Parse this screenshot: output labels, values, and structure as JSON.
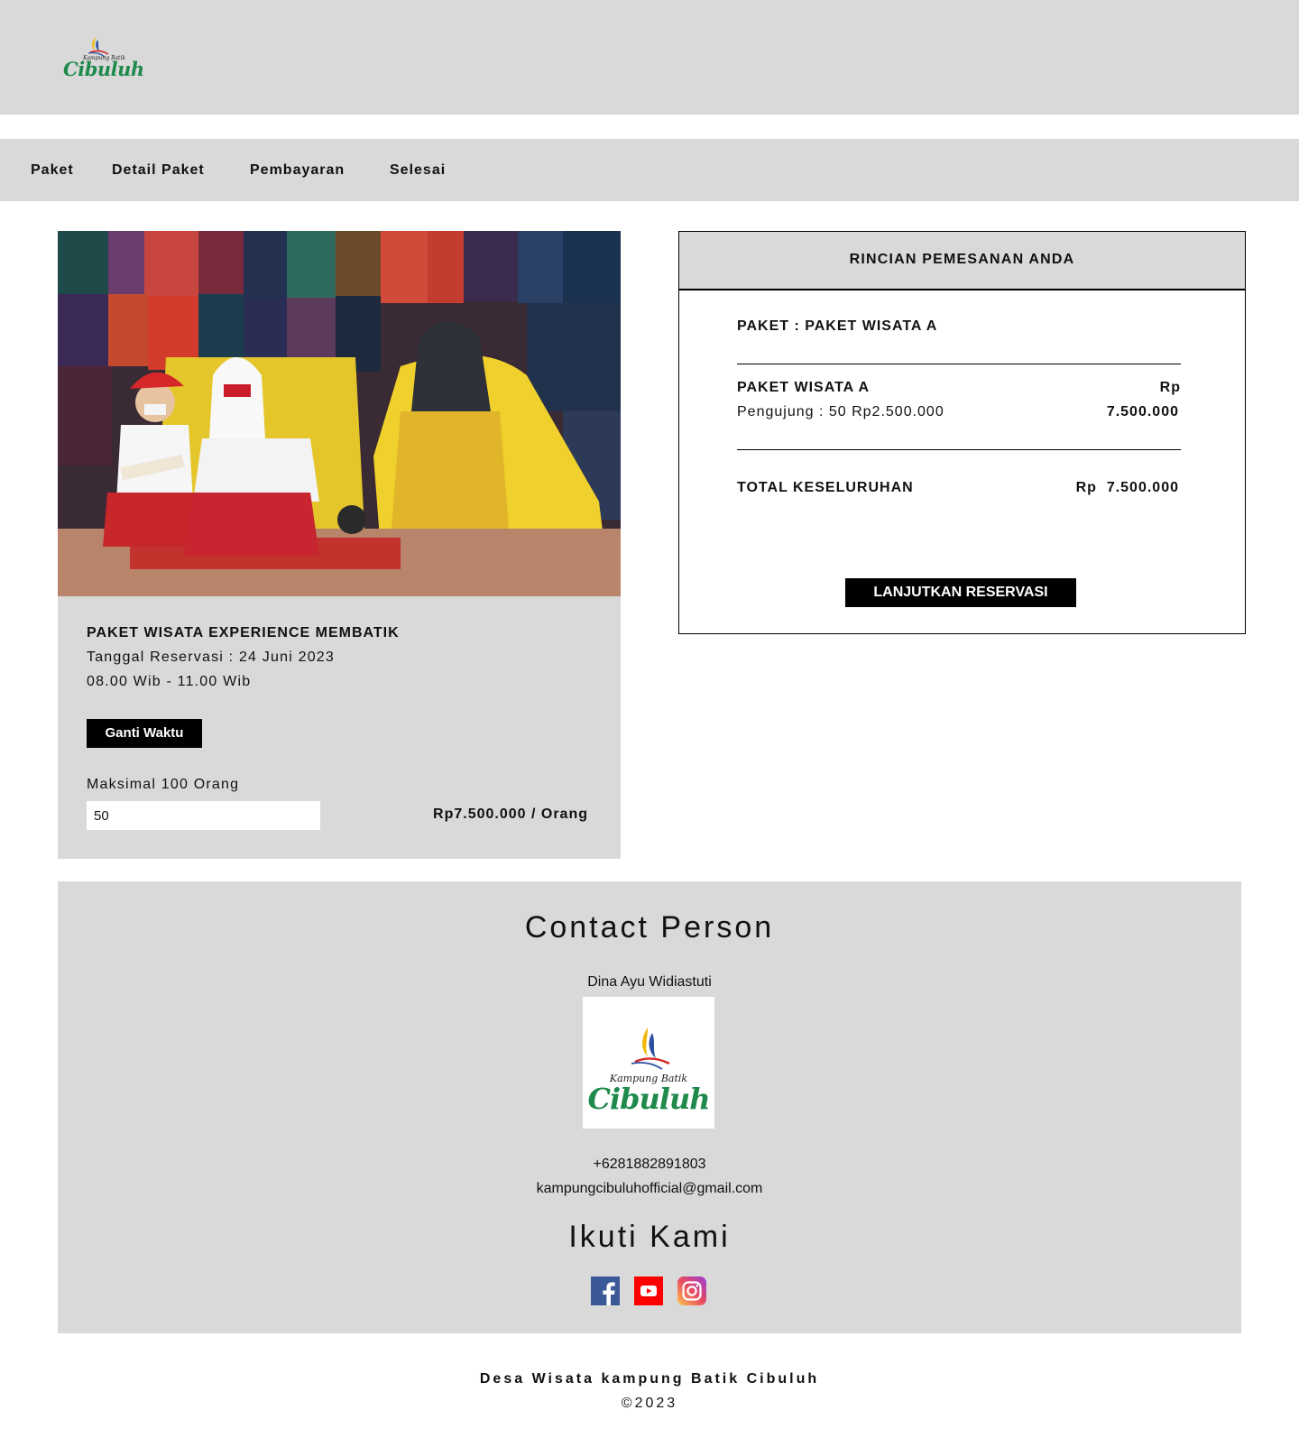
{
  "header": {
    "logo": {
      "icon": "kampung-batik-cibuluh-logo",
      "small_text": "Kampung Batik",
      "word": "Cibuluh"
    }
  },
  "nav": {
    "items": [
      {
        "label": "Paket"
      },
      {
        "label": "Detail Paket"
      },
      {
        "label": "Pembayaran"
      },
      {
        "label": "Selesai"
      }
    ]
  },
  "package": {
    "title": "PAKET WISATA EXPERIENCE MEMBATIK",
    "date": "Tanggal Reservasi : 24 Juni 2023",
    "time": "08.00 Wib - 11.00 Wib",
    "change_time_button": "Ganti Waktu",
    "max_label": "Maksimal 100  Orang",
    "visitor_input": {
      "value": "50"
    },
    "price": "Rp7.500.000 / Orang"
  },
  "order": {
    "heading": "RINCIAN PEMESANAN ANDA",
    "paket_line": "PAKET : PAKET WISATA A",
    "item_name": "PAKET WISATA A",
    "item_currency": "Rp",
    "item_detail": "Pengujung : 50 Rp2.500.000",
    "item_amount": "7.500.000",
    "total_label": "TOTAL KESELURUHAN",
    "total_amount": "Rp  7.500.000",
    "continue_button": "LANJUTKAN RESERVASI"
  },
  "contact": {
    "title": "Contact Person",
    "name": "Dina Ayu Widiastuti",
    "logo": {
      "small_text": "Kampung Batik",
      "word": "Cibuluh"
    },
    "phone": "+6281882891803",
    "email": "kampungcibuluhofficial@gmail.com",
    "follow_title": "Ikuti Kami",
    "social": [
      {
        "icon": "facebook-icon",
        "color": "#3b5998"
      },
      {
        "icon": "youtube-icon",
        "color": "#ff0000"
      },
      {
        "icon": "instagram-icon",
        "color": "#d6249f"
      }
    ]
  },
  "footer": {
    "name": "Desa Wisata kampung Batik Cibuluh",
    "copyright": "©2023"
  },
  "colors": {
    "panel_gray": "#d9d9d9",
    "button_black": "#000000",
    "brand_green": "#1f8a4c"
  }
}
